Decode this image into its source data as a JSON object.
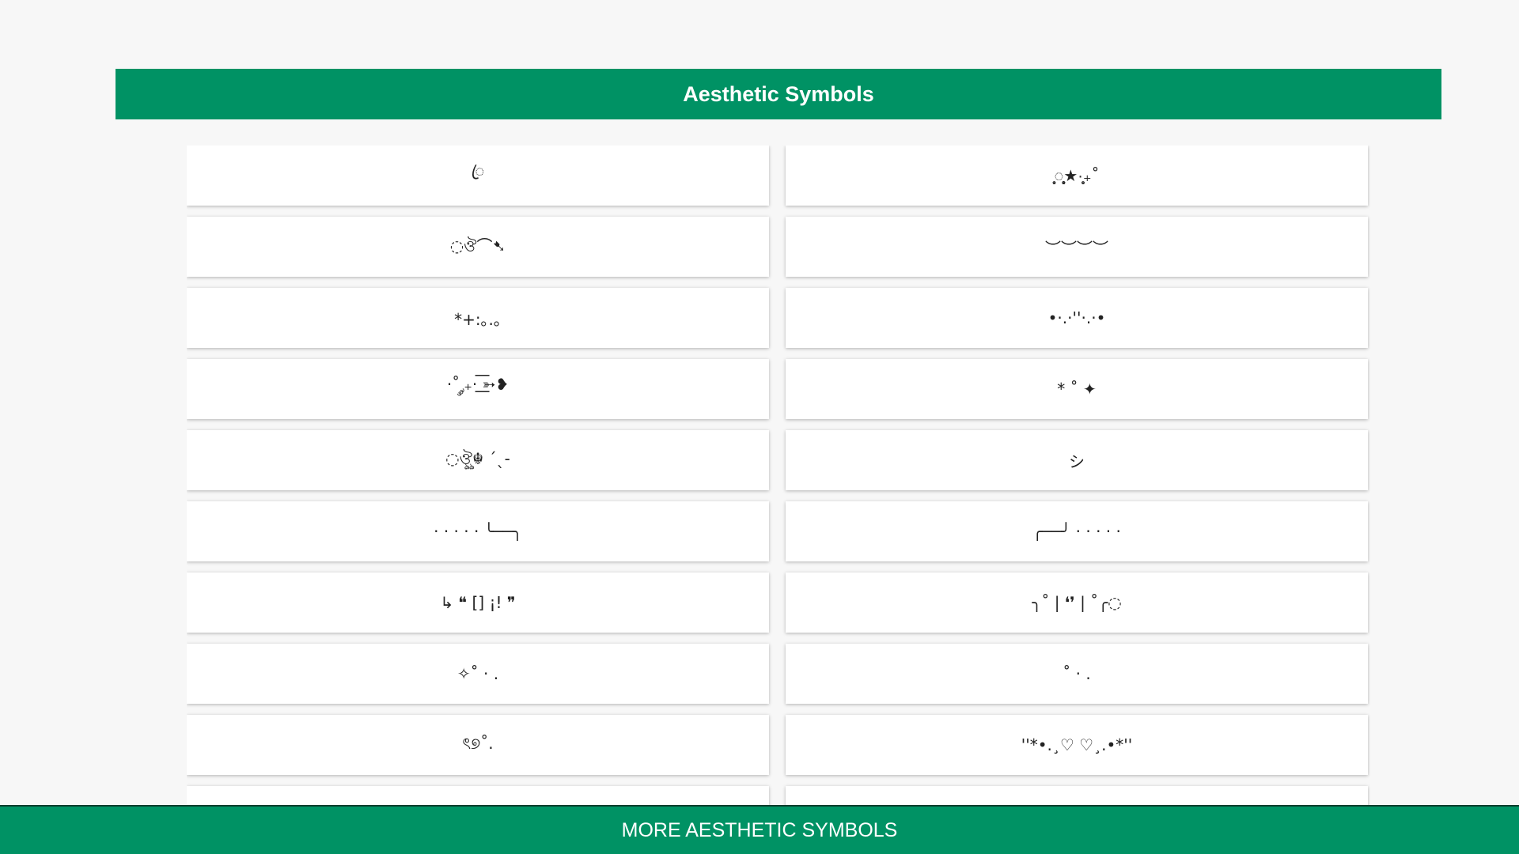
{
  "header": {
    "title": "Aesthetic Symbols"
  },
  "symbols": [
    "ꦿ",
    "̥͙◌̥̥̥͙★·͙̥₊˚",
    "◌ঔ⌒➷",
    "︶︶︶︶",
    "*+:｡.｡",
    "•·.·''·.·•",
    "·˚ ༘₊· ͟͟͞͞➳❥",
    "* ˚ ✦",
    "◌ঔৣ☬ ˊˎ-",
    "シ",
    "· · · · · ╰──╮",
    "╭──╯ · · · · ·",
    "↳ ❝ [] ¡! ❞",
    "╮˚ | ❛❜ | ˚╭◌",
    "✧˚ · .",
    "˚ · .",
    "ৎ୭˚.",
    "''*•.¸♡ ♡¸.•*''",
    "••",
    "•• ✦"
  ],
  "footer": {
    "label": "MORE AESTHETIC SYMBOLS"
  }
}
